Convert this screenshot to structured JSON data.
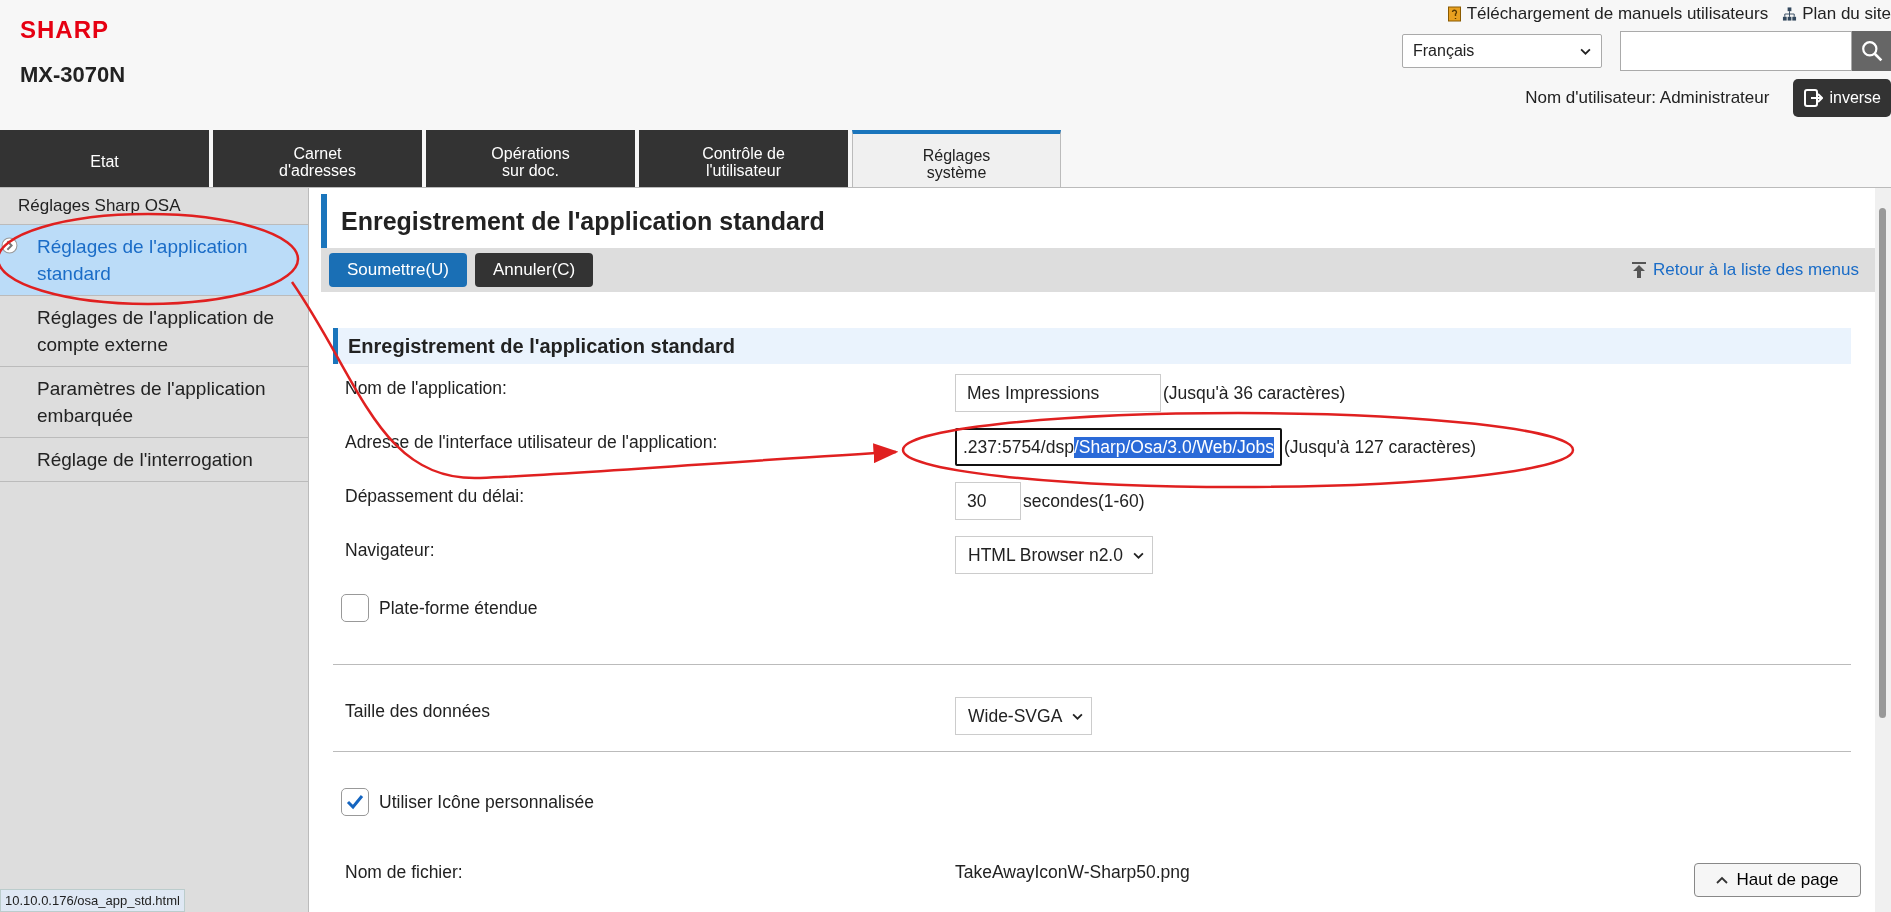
{
  "header": {
    "logo": "SHARP",
    "model": "MX-3070N",
    "links": [
      {
        "kind": "manual",
        "label": "Téléchargement de manuels utilisateurs"
      },
      {
        "kind": "sitemap",
        "label": "Plan du site"
      }
    ],
    "language": "Français",
    "user_label": "Nom d'utilisateur: Administrateur",
    "inverse_button": "inverse"
  },
  "tabs": [
    {
      "label": "Etat",
      "selected": false
    },
    {
      "label": "Carnet\nd'adresses",
      "selected": false
    },
    {
      "label": "Opérations\nsur doc.",
      "selected": false
    },
    {
      "label": "Contrôle de\nl'utilisateur",
      "selected": false
    },
    {
      "label": "Réglages\nsystème",
      "selected": true
    }
  ],
  "sidebar": {
    "heading": "Réglages Sharp OSA",
    "items": [
      {
        "label": "Réglages de l'application standard",
        "selected": true
      },
      {
        "label": "Réglages de l'application de compte externe",
        "selected": false
      },
      {
        "label": "Paramètres de l'application embarquée",
        "selected": false
      },
      {
        "label": "Réglage de l'interrogation",
        "selected": false
      }
    ]
  },
  "page_title": "Enregistrement de l'application standard",
  "toolbar": {
    "submit": "Soumettre(U)",
    "cancel": "Annuler(C)",
    "back_link": "Retour à la liste des menus"
  },
  "section_title": "Enregistrement de l'application standard",
  "rows": [
    {
      "kind": "text",
      "label": "Nom de l'application:",
      "value": "Mes Impressions",
      "hint": "(Jusqu'à 36 caractères)"
    },
    {
      "kind": "address",
      "label": "Adresse de l'interface utilisateur de l'application:",
      "value": ".237:5754/dsp",
      "selected_text": "/Sharp/Osa/3.0/Web/Jobs",
      "hint": "(Jusqu'à 127 caractères)"
    },
    {
      "kind": "short",
      "label": "Dépassement du délai:",
      "value": "30",
      "hint": "secondes(1-60)"
    },
    {
      "kind": "select",
      "label": "Navigateur:",
      "value": "HTML Browser n2.0"
    },
    {
      "kind": "checkbox",
      "label": "Plate-forme étendue",
      "checked": false
    },
    {
      "kind": "divider"
    },
    {
      "kind": "select",
      "label": "Taille des données",
      "value": "Wide-SVGA"
    },
    {
      "kind": "divider"
    },
    {
      "kind": "checkbox",
      "label": "Utiliser Icône personnalisée",
      "checked": true
    },
    {
      "kind": "plain",
      "label": "Nom de fichier:",
      "value": "TakeAwayIconW-Sharp50.png"
    }
  ],
  "status_url": "10.10.0.176/osa_app_std.html",
  "top_button": "Haut de page"
}
